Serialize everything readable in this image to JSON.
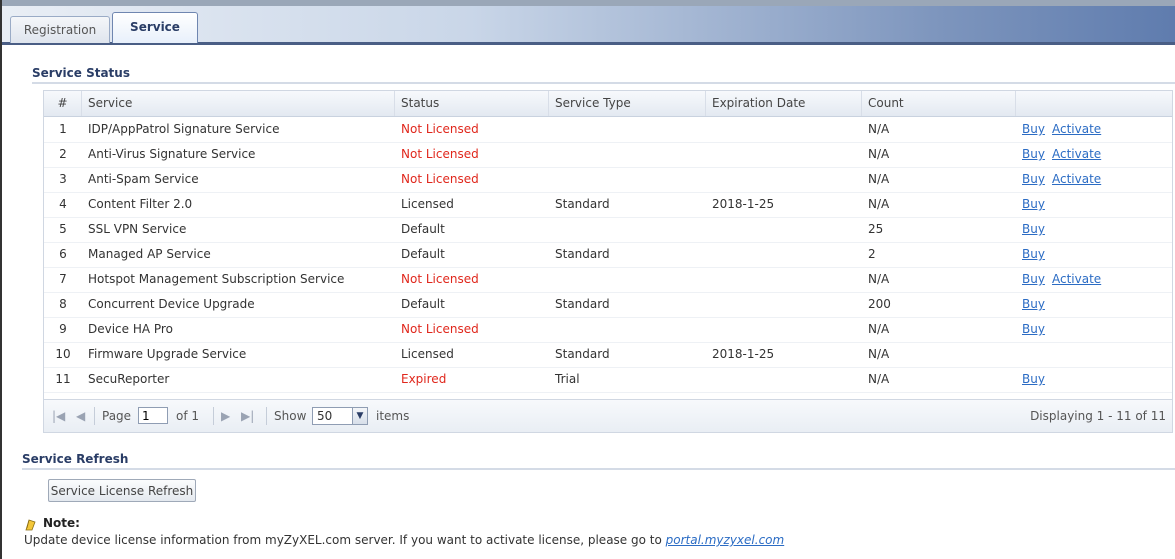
{
  "tabs": [
    {
      "label": "Registration",
      "active": false
    },
    {
      "label": "Service",
      "active": true
    }
  ],
  "service_status": {
    "title": "Service Status",
    "columns": [
      "#",
      "Service",
      "Status",
      "Service Type",
      "Expiration Date",
      "Count",
      ""
    ],
    "rows": [
      {
        "num": "1",
        "service": "IDP/AppPatrol Signature Service",
        "status": "Not Licensed",
        "status_alert": true,
        "type": "",
        "expiration": "",
        "count": "N/A",
        "buy": "Buy",
        "activate": "Activate"
      },
      {
        "num": "2",
        "service": "Anti-Virus Signature Service",
        "status": "Not Licensed",
        "status_alert": true,
        "type": "",
        "expiration": "",
        "count": "N/A",
        "buy": "Buy",
        "activate": "Activate"
      },
      {
        "num": "3",
        "service": "Anti-Spam Service",
        "status": "Not Licensed",
        "status_alert": true,
        "type": "",
        "expiration": "",
        "count": "N/A",
        "buy": "Buy",
        "activate": "Activate"
      },
      {
        "num": "4",
        "service": "Content Filter 2.0",
        "status": "Licensed",
        "status_alert": false,
        "type": "Standard",
        "expiration": "2018-1-25",
        "count": "N/A",
        "buy": "Buy",
        "activate": ""
      },
      {
        "num": "5",
        "service": "SSL VPN Service",
        "status": "Default",
        "status_alert": false,
        "type": "",
        "expiration": "",
        "count": "25",
        "buy": "Buy",
        "activate": ""
      },
      {
        "num": "6",
        "service": "Managed AP Service",
        "status": "Default",
        "status_alert": false,
        "type": "Standard",
        "expiration": "",
        "count": "2",
        "buy": "Buy",
        "activate": ""
      },
      {
        "num": "7",
        "service": "Hotspot Management Subscription Service",
        "status": "Not Licensed",
        "status_alert": true,
        "type": "",
        "expiration": "",
        "count": "N/A",
        "buy": "Buy",
        "activate": "Activate"
      },
      {
        "num": "8",
        "service": "Concurrent Device Upgrade",
        "status": "Default",
        "status_alert": false,
        "type": "Standard",
        "expiration": "",
        "count": "200",
        "buy": "Buy",
        "activate": ""
      },
      {
        "num": "9",
        "service": "Device HA Pro",
        "status": "Not Licensed",
        "status_alert": true,
        "type": "",
        "expiration": "",
        "count": "N/A",
        "buy": "Buy",
        "activate": ""
      },
      {
        "num": "10",
        "service": "Firmware Upgrade Service",
        "status": "Licensed",
        "status_alert": false,
        "type": "Standard",
        "expiration": "2018-1-25",
        "count": "N/A",
        "buy": "",
        "activate": ""
      },
      {
        "num": "11",
        "service": "SecuReporter",
        "status": "Expired",
        "status_alert": true,
        "type": "Trial",
        "expiration": "",
        "count": "N/A",
        "buy": "Buy",
        "activate": ""
      }
    ]
  },
  "pager": {
    "page_label": "Page",
    "page_value": "1",
    "of_label": "of 1",
    "show_label": "Show",
    "show_value": "50",
    "items_label": "items",
    "display_text": "Displaying 1 - 11 of 11"
  },
  "service_refresh": {
    "title": "Service Refresh",
    "button_label": "Service License Refresh"
  },
  "note": {
    "label": "Note:",
    "text": "Update device license information from myZyXEL.com server. If you want to activate license, please go to",
    "link": "portal.myzyxel.com"
  },
  "colors": {
    "alert_status": "#e0271c",
    "link": "#2b6cc4",
    "heading": "#2a3d66"
  }
}
